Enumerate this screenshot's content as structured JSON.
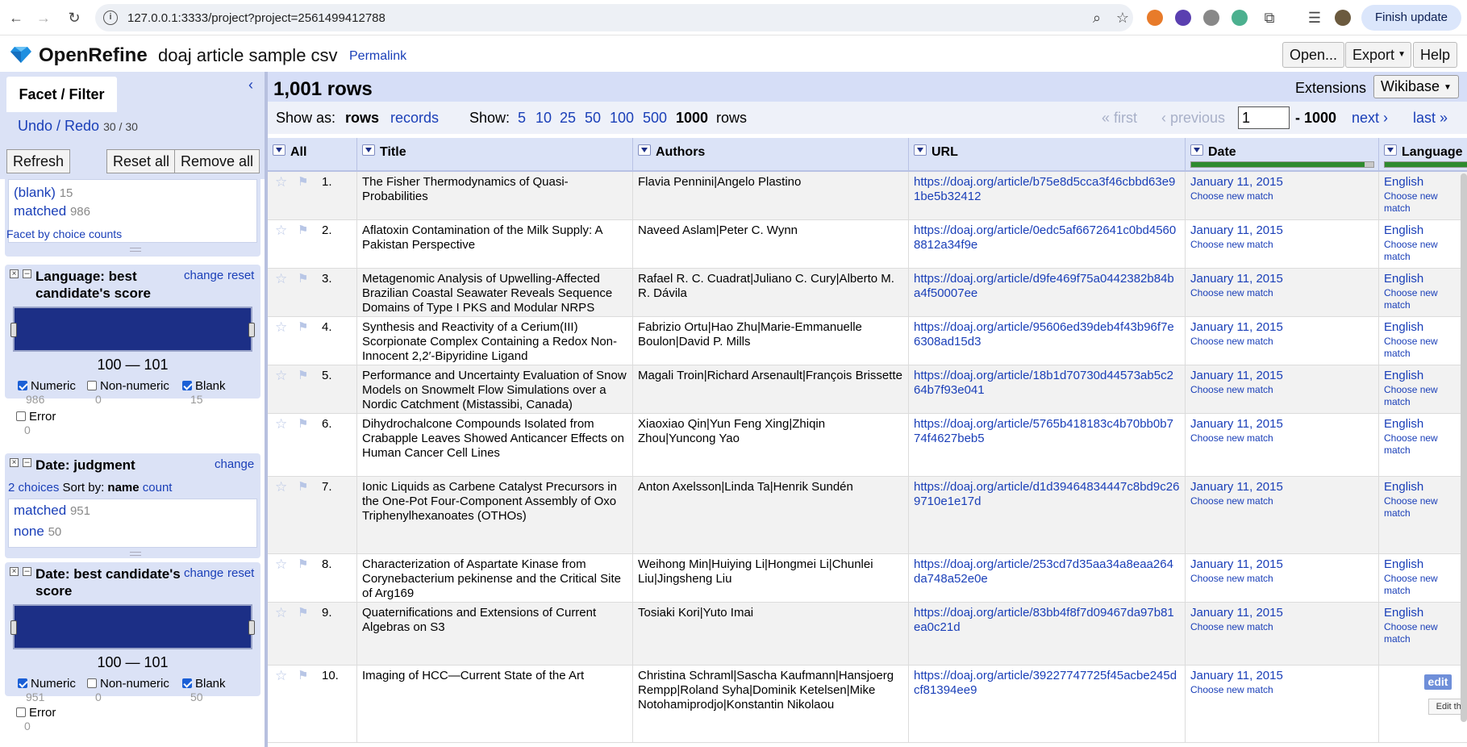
{
  "browser": {
    "url": "127.0.0.1:3333/project?project=2561499412788",
    "finish_update": "Finish update"
  },
  "app": {
    "logo_text": "OpenRefine",
    "project_name": "doaj article sample csv",
    "permalink": "Permalink",
    "open_label": "Open...",
    "export_label": "Export",
    "help_label": "Help"
  },
  "left": {
    "tab_label": "Facet / Filter",
    "undo_redo": "Undo / Redo",
    "undo_count": "30 / 30",
    "refresh": "Refresh",
    "reset_all": "Reset all",
    "remove_all": "Remove all",
    "facet0": {
      "blank_label": "(blank)",
      "blank_count": "15",
      "matched_label": "matched",
      "matched_count": "986",
      "facet_by_counts": "Facet by choice counts"
    },
    "facet1": {
      "title": "Language: best candidate's score",
      "change": "change",
      "reset": "reset",
      "range": "100 — 101",
      "numeric": "Numeric",
      "numeric_count": "986",
      "nonnumeric": "Non-numeric",
      "nonnumeric_count": "0",
      "blank": "Blank",
      "blank_count": "15",
      "error": "Error",
      "error_count": "0"
    },
    "facet2": {
      "title": "Date: judgment",
      "change": "change",
      "choices": "2 choices",
      "sort_by": "Sort by:",
      "sort_name": "name",
      "sort_count": "count",
      "matched_label": "matched",
      "matched_count": "951",
      "none_label": "none",
      "none_count": "50"
    },
    "facet3": {
      "title": "Date: best candidate's score",
      "change": "change",
      "reset": "reset",
      "range": "100 — 101",
      "numeric": "Numeric",
      "numeric_count": "951",
      "nonnumeric": "Non-numeric",
      "nonnumeric_count": "0",
      "blank": "Blank",
      "blank_count": "50",
      "error": "Error",
      "error_count": "0"
    }
  },
  "grid": {
    "row_count": "1,001 rows",
    "extensions": "Extensions",
    "wikibase": "Wikibase",
    "show_as": "Show as:",
    "rows_mode": "rows",
    "records_mode": "records",
    "show": "Show:",
    "sizes": [
      "5",
      "10",
      "25",
      "50",
      "100",
      "500"
    ],
    "current_size": "1000",
    "rows_word": "rows",
    "first": "« first",
    "previous": "‹ previous",
    "page": "1",
    "page_end": "- 1000",
    "next": "next ›",
    "last": "last »",
    "columns": [
      "All",
      "Title",
      "Authors",
      "URL",
      "Date",
      "Language"
    ],
    "date_recon_fraction": 0.95,
    "language_recon_fraction": 0.98,
    "choose_new_match": "Choose new match",
    "edit_label": "edit",
    "edit_tooltip": "Edit this cell",
    "rows": [
      {
        "idx": "1.",
        "title": "The Fisher Thermodynamics of Quasi-Probabilities",
        "authors": "Flavia Pennini|Angelo Plastino",
        "url": "https://doaj.org/article/b75e8d5cca3f46cbbd63e91be5b32412",
        "date": "January 11, 2015",
        "language": "English"
      },
      {
        "idx": "2.",
        "title": "Aflatoxin Contamination of the Milk Supply: A Pakistan Perspective",
        "authors": "Naveed Aslam|Peter C. Wynn",
        "url": "https://doaj.org/article/0edc5af6672641c0bd45608812a34f9e",
        "date": "January 11, 2015",
        "language": "English"
      },
      {
        "idx": "3.",
        "title": "Metagenomic Analysis of Upwelling-Affected Brazilian Coastal Seawater Reveals Sequence Domains of Type I PKS and Modular NRPS",
        "authors": "Rafael R. C. Cuadrat|Juliano C. Cury|Alberto M. R. Dávila",
        "url": "https://doaj.org/article/d9fe469f75a0442382b84ba4f50007ee",
        "date": "January 11, 2015",
        "language": "English"
      },
      {
        "idx": "4.",
        "title": "Synthesis and Reactivity of a Cerium(III) Scorpionate Complex Containing a Redox Non-Innocent 2,2′-Bipyridine Ligand",
        "authors": "Fabrizio Ortu|Hao Zhu|Marie-Emmanuelle Boulon|David P. Mills",
        "url": "https://doaj.org/article/95606ed39deb4f43b96f7e6308ad15d3",
        "date": "January 11, 2015",
        "language": "English"
      },
      {
        "idx": "5.",
        "title": "Performance and Uncertainty Evaluation of Snow Models on Snowmelt Flow Simulations over a Nordic Catchment (Mistassibi, Canada)",
        "authors": "Magali Troin|Richard Arsenault|François Brissette",
        "url": "https://doaj.org/article/18b1d70730d44573ab5c264b7f93e041",
        "date": "January 11, 2015",
        "language": "English"
      },
      {
        "idx": "6.",
        "title": "Dihydrochalcone Compounds Isolated from Crabapple Leaves Showed Anticancer Effects on Human Cancer Cell Lines",
        "authors": "Xiaoxiao Qin|Yun Feng Xing|Zhiqin Zhou|Yuncong Yao",
        "url": "https://doaj.org/article/5765b418183c4b70bb0b774f4627beb5",
        "date": "January 11, 2015",
        "language": "English"
      },
      {
        "idx": "7.",
        "title": "Ionic Liquids as Carbene Catalyst Precursors in the One-Pot Four-Component Assembly of Oxo Triphenylhexanoates (OTHOs)",
        "authors": "Anton Axelsson|Linda Ta|Henrik Sundén",
        "url": "https://doaj.org/article/d1d39464834447c8bd9c269710e1e17d",
        "date": "January 11, 2015",
        "language": "English"
      },
      {
        "idx": "8.",
        "title": "Characterization of Aspartate Kinase from Corynebacterium pekinense and the Critical Site of Arg169",
        "authors": "Weihong Min|Huiying Li|Hongmei Li|Chunlei Liu|Jingsheng Liu",
        "url": "https://doaj.org/article/253cd7d35aa34a8eaa264da748a52e0e",
        "date": "January 11, 2015",
        "language": "English"
      },
      {
        "idx": "9.",
        "title": "Quaternifications and Extensions of Current Algebras on S3",
        "authors": "Tosiaki Kori|Yuto Imai",
        "url": "https://doaj.org/article/83bb4f8f7d09467da97b81ea0c21d",
        "date": "January 11, 2015",
        "language": "English"
      },
      {
        "idx": "10.",
        "title": "Imaging of HCC—Current State of the Art",
        "authors": "Christina Schraml|Sascha Kaufmann|Hansjoerg Rempp|Roland Syha|Dominik Ketelsen|Mike Notohamiprodjo|Konstantin Nikolaou",
        "url": "https://doaj.org/article/39227747725f45acbe245dcf81394ee9",
        "date": "January 11, 2015",
        "language": ""
      }
    ]
  }
}
